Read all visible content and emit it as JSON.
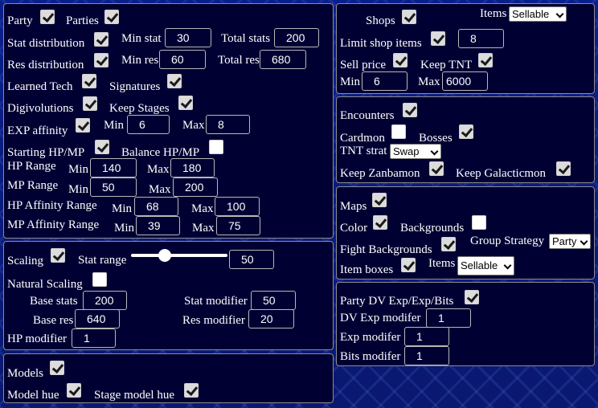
{
  "party_panel": {
    "party": {
      "label": "Party",
      "checked": true
    },
    "parties": {
      "label": "Parties",
      "checked": true
    },
    "stat_distribution": {
      "label": "Stat distribution",
      "checked": true
    },
    "min_stat": {
      "label": "Min stat",
      "value": "30"
    },
    "total_stats": {
      "label": "Total stats",
      "value": "200"
    },
    "res_distribution": {
      "label": "Res distribution",
      "checked": true
    },
    "min_res": {
      "label": "Min res",
      "value": "60"
    },
    "total_res": {
      "label": "Total res",
      "value": "680"
    },
    "learned_tech": {
      "label": "Learned Tech",
      "checked": true
    },
    "signatures": {
      "label": "Signatures",
      "checked": true
    },
    "digivolutions": {
      "label": "Digivolutions",
      "checked": true
    },
    "keep_stages": {
      "label": "Keep Stages",
      "checked": true
    },
    "exp_affinity": {
      "label": "EXP affinity",
      "checked": true,
      "min_label": "Min",
      "min": "6",
      "max_label": "Max",
      "max": "8"
    },
    "starting_hp_mp": {
      "label": "Starting HP/MP",
      "checked": true
    },
    "balance_hp_mp": {
      "label": "Balance HP/MP",
      "checked": false
    },
    "hp_range": {
      "label": "HP Range",
      "min_label": "Min",
      "min": "140",
      "max_label": "Max",
      "max": "180"
    },
    "mp_range": {
      "label": "MP Range",
      "min_label": "Min",
      "min": "50",
      "max_label": "Max",
      "max": "200"
    },
    "hp_affinity_range": {
      "label": "HP Affinity Range",
      "min_label": "Min",
      "min": "68",
      "max_label": "Max",
      "max": "100"
    },
    "mp_affinity_range": {
      "label": "MP Affinity Range",
      "min_label": "Min",
      "min": "39",
      "max_label": "Max",
      "max": "75"
    }
  },
  "scaling_panel": {
    "scaling": {
      "label": "Scaling",
      "checked": true
    },
    "stat_range": {
      "label": "Stat range",
      "value": "50",
      "fraction": 0.33
    },
    "natural_scaling": {
      "label": "Natural Scaling",
      "checked": false
    },
    "base_stats": {
      "label": "Base stats",
      "value": "200"
    },
    "stat_modifier": {
      "label": "Stat modifier",
      "value": "50"
    },
    "base_res": {
      "label": "Base res",
      "value": "640"
    },
    "res_modifier": {
      "label": "Res modifier",
      "value": "20"
    },
    "hp_modifier": {
      "label": "HP modifier",
      "value": "1"
    }
  },
  "models_panel": {
    "models": {
      "label": "Models",
      "checked": true
    },
    "model_hue": {
      "label": "Model hue",
      "checked": true
    },
    "stage_model_hue": {
      "label": "Stage model hue",
      "checked": true
    }
  },
  "shops_panel": {
    "shops": {
      "label": "Shops",
      "checked": true
    },
    "items": {
      "label": "Items",
      "selected": "Sellable"
    },
    "limit_shop_items": {
      "label": "Limit shop items",
      "checked": true,
      "value": "8"
    },
    "sell_price": {
      "label": "Sell price",
      "checked": true
    },
    "keep_tnt": {
      "label": "Keep TNT",
      "checked": true
    },
    "min_label": "Min",
    "min": "6",
    "max_label": "Max",
    "max": "6000"
  },
  "encounters_panel": {
    "encounters": {
      "label": "Encounters",
      "checked": true
    },
    "cardmon": {
      "label": "Cardmon",
      "checked": false
    },
    "bosses": {
      "label": "Bosses",
      "checked": true
    },
    "tnt_strat": {
      "label": "TNT strat",
      "selected": "Swap"
    },
    "keep_zanbamon": {
      "label": "Keep Zanbamon",
      "checked": true
    },
    "keep_galacticmon": {
      "label": "Keep Galacticmon",
      "checked": true
    }
  },
  "maps_panel": {
    "maps": {
      "label": "Maps",
      "checked": true
    },
    "color": {
      "label": "Color",
      "checked": true
    },
    "backgrounds": {
      "label": "Backgrounds",
      "checked": false
    },
    "fight_backgrounds": {
      "label": "Fight Backgrounds",
      "checked": true
    },
    "group_strategy": {
      "label": "Group Strategy",
      "selected": "Party"
    },
    "item_boxes": {
      "label": "Item boxes",
      "checked": true
    },
    "items": {
      "label": "Items",
      "selected": "Sellable"
    }
  },
  "exp_panel": {
    "party_dv_exp_bits": {
      "label": "Party DV Exp/Exp/Bits",
      "checked": true
    },
    "dv_exp_modifier": {
      "label": "DV Exp modifer",
      "value": "1"
    },
    "exp_modifier": {
      "label": "Exp modifer",
      "value": "1"
    },
    "bits_modifier": {
      "label": "Bits modifer",
      "value": "1"
    }
  },
  "colors": {
    "panel_bg": "#000033",
    "panel_border": "#8c8c8c",
    "page_bg": "#0a1a78"
  }
}
